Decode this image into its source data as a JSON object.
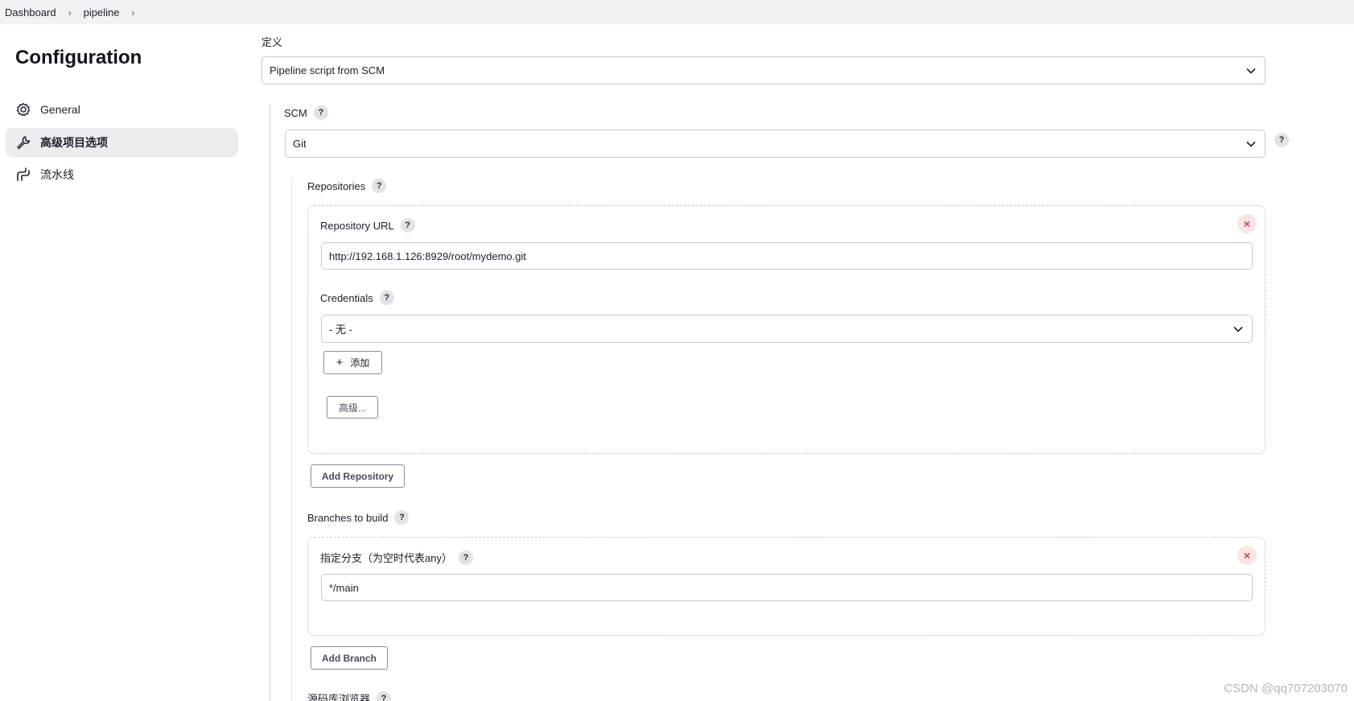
{
  "breadcrumb": {
    "items": [
      "Dashboard",
      "pipeline"
    ]
  },
  "page": {
    "title": "Configuration"
  },
  "sidebar": {
    "items": [
      {
        "label": "General",
        "icon": "gear-icon"
      },
      {
        "label": "高级项目选项",
        "icon": "wrench-icon",
        "active": true
      },
      {
        "label": "流水线",
        "icon": "pipeline-icon"
      }
    ]
  },
  "definition": {
    "label": "定义",
    "value": "Pipeline script from SCM"
  },
  "scm": {
    "label": "SCM",
    "value": "Git"
  },
  "repositories": {
    "label": "Repositories",
    "url_label": "Repository URL",
    "url_value": "http://192.168.1.126:8929/root/mydemo.git",
    "credentials_label": "Credentials",
    "credentials_value": "- 无 -",
    "add_label": "添加",
    "advanced_label": "高级...",
    "add_repository_label": "Add Repository"
  },
  "branches": {
    "label": "Branches to build",
    "branch_label": "指定分支（为空时代表any）",
    "branch_value": "*/main",
    "add_branch_label": "Add Branch"
  },
  "browser": {
    "label": "源码库浏览器"
  },
  "watermark": "CSDN @qq707203070",
  "colors": {
    "accent_close": "#d33a4a",
    "active_bg": "#ececef",
    "border": "#c6c7cc"
  }
}
